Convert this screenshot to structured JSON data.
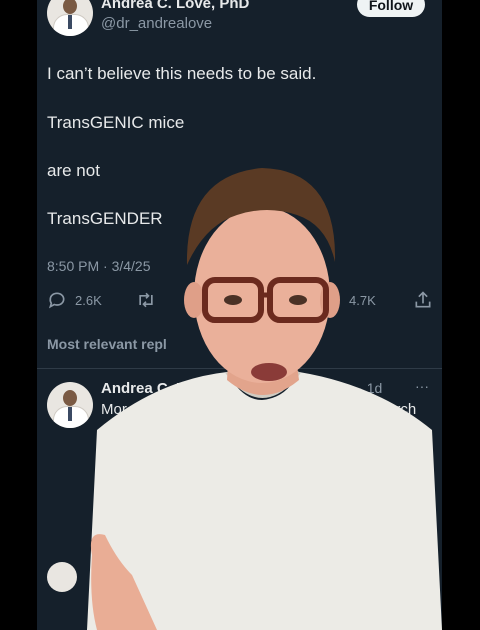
{
  "tweet": {
    "author_name": "Andrea C. Love, PhD",
    "author_handle": "@dr_andrealove",
    "follow_label": "Follow",
    "lines": [
      "I can’t believe this needs to be said.",
      "TransGENIC mice",
      "are not",
      "TransGENDER"
    ],
    "timestamp": "8:50 PM · 3/4/25",
    "actions": {
      "replies": "2.6K",
      "bookmarks": "4.7K"
    }
  },
  "replies_header": "Most relevant repl",
  "reply": {
    "author_name": "Andrea C. L",
    "meta": "ealove · 1d",
    "more_icon": "···",
    "text_left": "Mor",
    "text_right": "arch"
  },
  "icons": [
    "reply-icon",
    "retweet-icon",
    "bookmark-icon",
    "share-icon",
    "more-icon"
  ]
}
